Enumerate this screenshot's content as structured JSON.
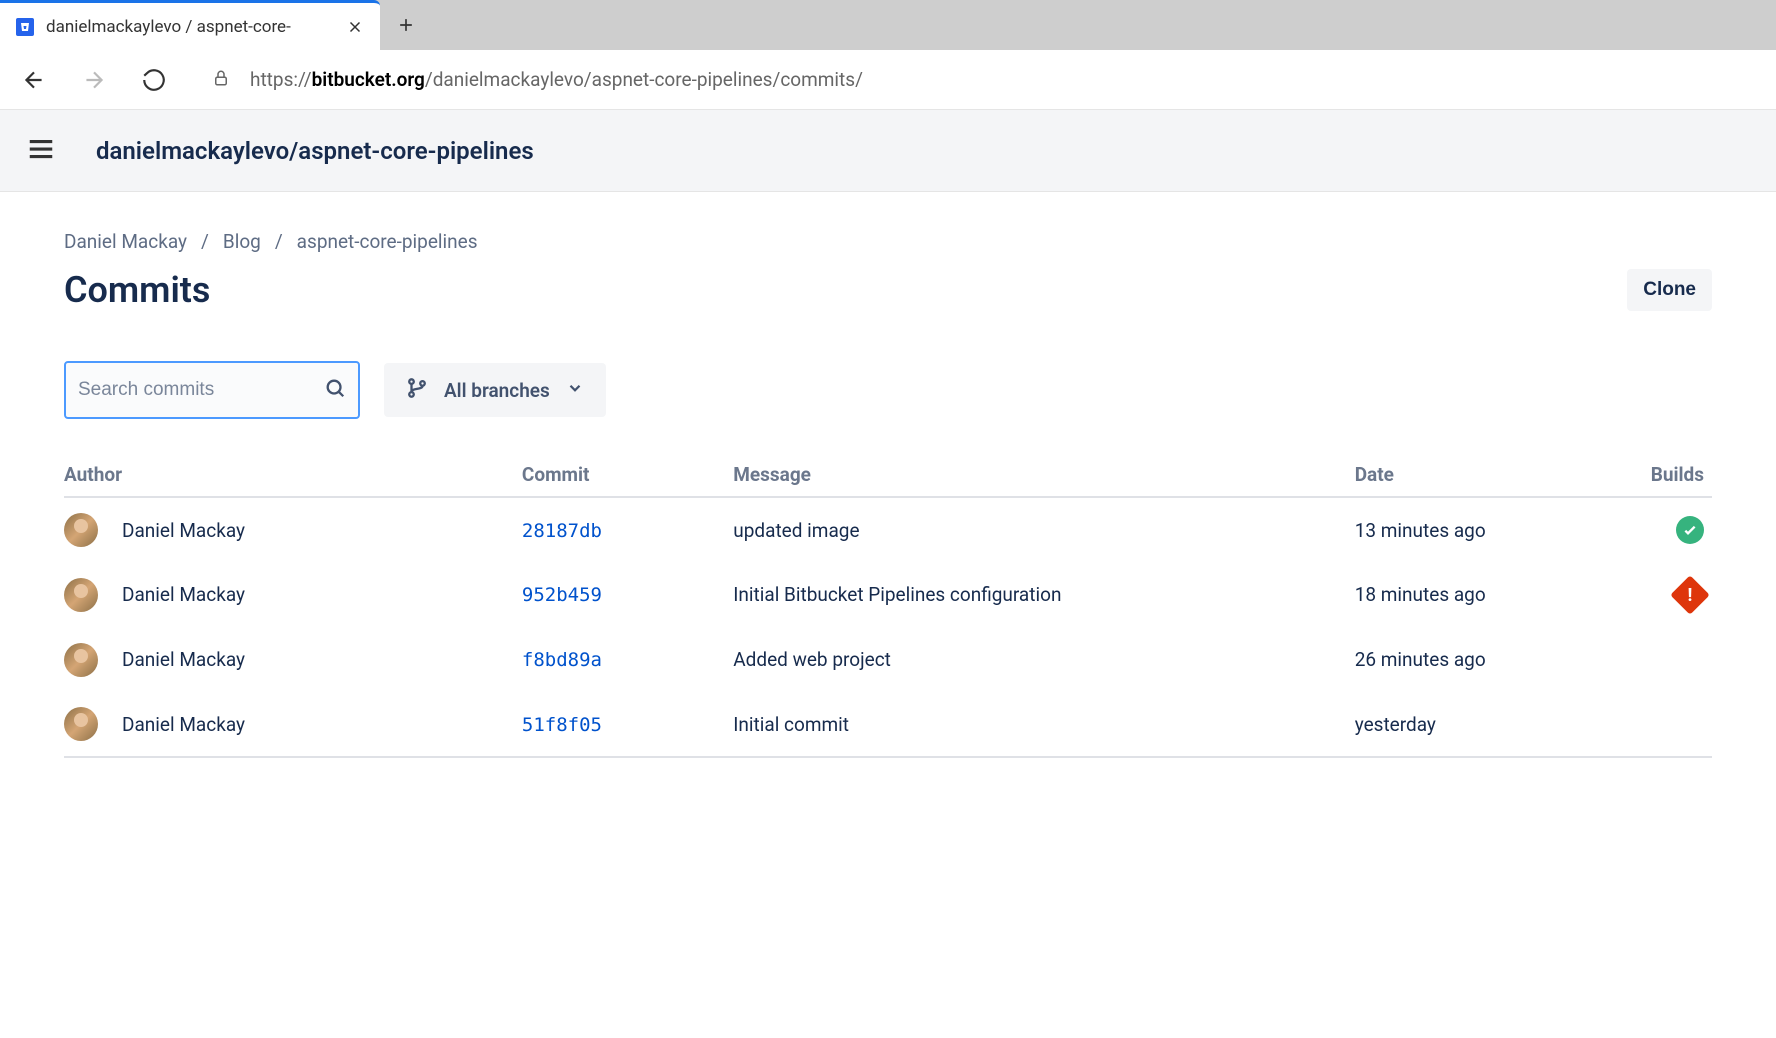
{
  "browser": {
    "tab_title": "danielmackaylevo / aspnet-core-",
    "url_prefix": "https://",
    "url_bold": "bitbucket.org",
    "url_rest": "/danielmackaylevo/aspnet-core-pipelines/commits/"
  },
  "header": {
    "repo_title": "danielmackaylevo/aspnet-core-pipelines"
  },
  "breadcrumb": {
    "owner": "Daniel Mackay",
    "project": "Blog",
    "repo": "aspnet-core-pipelines"
  },
  "page": {
    "title": "Commits",
    "clone_label": "Clone"
  },
  "filters": {
    "search_placeholder": "Search commits",
    "branch_label": "All branches"
  },
  "table": {
    "headers": {
      "author": "Author",
      "commit": "Commit",
      "message": "Message",
      "date": "Date",
      "builds": "Builds"
    },
    "rows": [
      {
        "author": "Daniel Mackay",
        "hash": "28187db",
        "message": "updated image",
        "date": "13 minutes ago",
        "build": "success"
      },
      {
        "author": "Daniel Mackay",
        "hash": "952b459",
        "message": "Initial Bitbucket Pipelines configuration",
        "date": "18 minutes ago",
        "build": "fail"
      },
      {
        "author": "Daniel Mackay",
        "hash": "f8bd89a",
        "message": "Added web project",
        "date": "26 minutes ago",
        "build": "none"
      },
      {
        "author": "Daniel Mackay",
        "hash": "51f8f05",
        "message": "Initial commit",
        "date": "yesterday",
        "build": "none"
      }
    ]
  }
}
